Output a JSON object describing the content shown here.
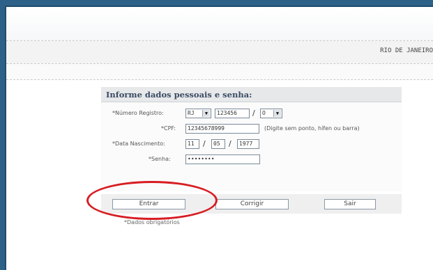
{
  "header": {
    "location": "RIO DE JANEIRO"
  },
  "form": {
    "title": "Informe dados pessoais e senha:",
    "registro": {
      "label": "*Número Registro:",
      "uf_value": "RJ",
      "numero_value": "123456",
      "digito_value": "O",
      "separator": "/"
    },
    "cpf": {
      "label": "*CPF:",
      "value": "12345678999",
      "hint": "(Digite sem ponto, hífen ou barra)"
    },
    "nascimento": {
      "label": "*Data Nascimento:",
      "day": "11",
      "month": "05",
      "year": "1977",
      "separator": "/"
    },
    "senha": {
      "label": "*Senha:",
      "value": "••••••••"
    },
    "buttons": {
      "enter": "Entrar",
      "reset": "Corrigir",
      "exit": "Sair"
    },
    "required_note": "*Dados obrigatórios"
  },
  "annotation": {
    "ring_color": "#d81c22"
  }
}
